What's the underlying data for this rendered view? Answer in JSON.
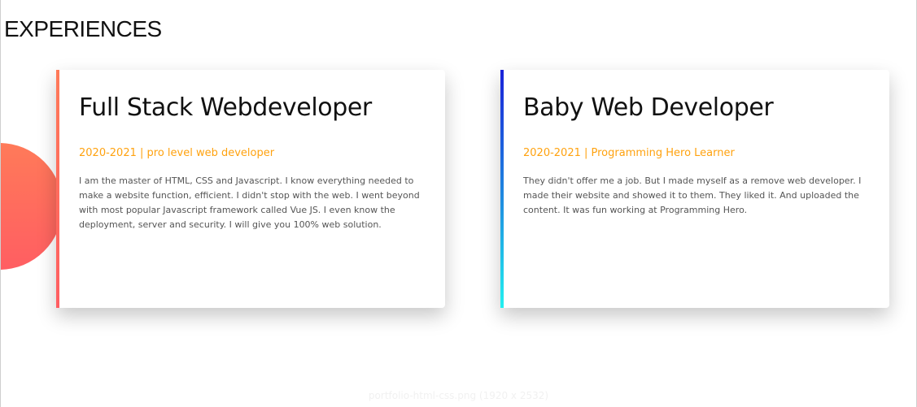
{
  "section": {
    "title": "EXPERIENCES"
  },
  "cards": [
    {
      "title": "Full Stack Webdeveloper",
      "meta": "2020-2021 | pro level web developer",
      "description": "I am the master of HTML, CSS and Javascript. I know everything needed to make a website function, efficient. I didn't stop with the web. I went beyond with most popular Javascript framework called Vue JS. I even know the deployment, server and security. I will give you 100% web solution.",
      "accent_colors": [
        "#ff7a59",
        "#ff5e62"
      ]
    },
    {
      "title": "Baby Web Developer",
      "meta": "2020-2021 | Programming Hero Learner",
      "description": "They didn't offer me a job. But I made myself as a remove web developer. I made their website and showed it to them. They liked it. And uploaded the content. It was fun working at Programming Hero.",
      "accent_colors": [
        "#1a22d9",
        "#1f8de0",
        "#22f0f0"
      ]
    }
  ],
  "theme": {
    "meta_color": "#ffa20f",
    "title_color": "#111111",
    "text_color": "#555555"
  },
  "footer": {
    "watermark": "portfolio-html-css.png (1920 x 2532)"
  }
}
